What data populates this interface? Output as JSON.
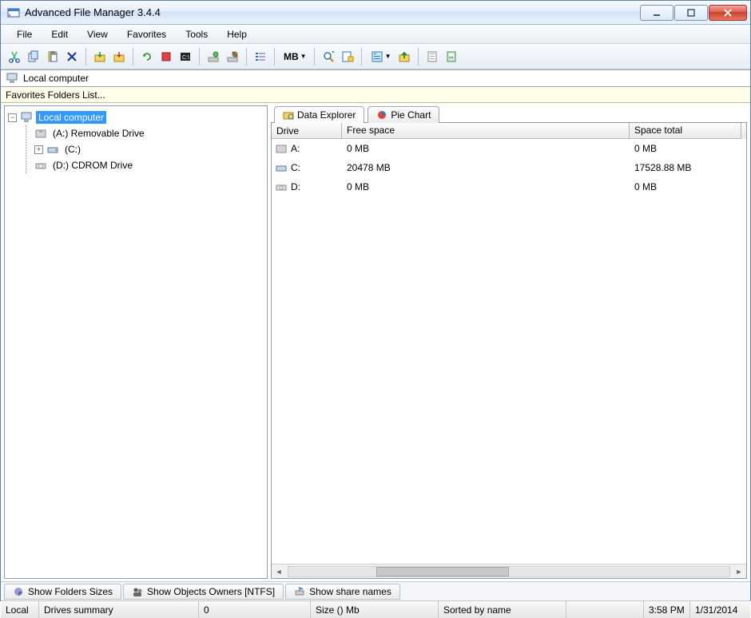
{
  "window": {
    "title": "Advanced File Manager 3.4.4"
  },
  "menubar": [
    "File",
    "Edit",
    "View",
    "Favorites",
    "Tools",
    "Help"
  ],
  "toolbar": {
    "size_unit": "MB"
  },
  "address": {
    "label": "Local computer"
  },
  "favbar": {
    "label": "Favorites Folders List..."
  },
  "tree": {
    "root_label": "Local computer",
    "items": [
      {
        "label": "(A:)  Removable Drive"
      },
      {
        "label": "(C:)"
      },
      {
        "label": "(D:)  CDROM Drive"
      }
    ]
  },
  "tabs": {
    "data_explorer": "Data Explorer",
    "pie_chart": "Pie Chart"
  },
  "grid": {
    "columns": {
      "drive": "Drive",
      "free": "Free space",
      "total": "Space total"
    },
    "rows": [
      {
        "drive": "A:",
        "free": "0 MB",
        "total": "0 MB"
      },
      {
        "drive": "C:",
        "free": "20478 MB",
        "total": "17528.88 MB"
      },
      {
        "drive": "D:",
        "free": "0 MB",
        "total": "0 MB"
      }
    ]
  },
  "bottom_tabs": {
    "folder_sizes": "Show Folders Sizes",
    "owners": "Show Objects Owners [NTFS]",
    "shares": "Show share names"
  },
  "status": {
    "scope": "Local",
    "summary": "Drives summary",
    "count": "0",
    "size": "Size () Mb",
    "sort": "Sorted by name",
    "time": "3:58 PM",
    "date": "1/31/2014"
  }
}
